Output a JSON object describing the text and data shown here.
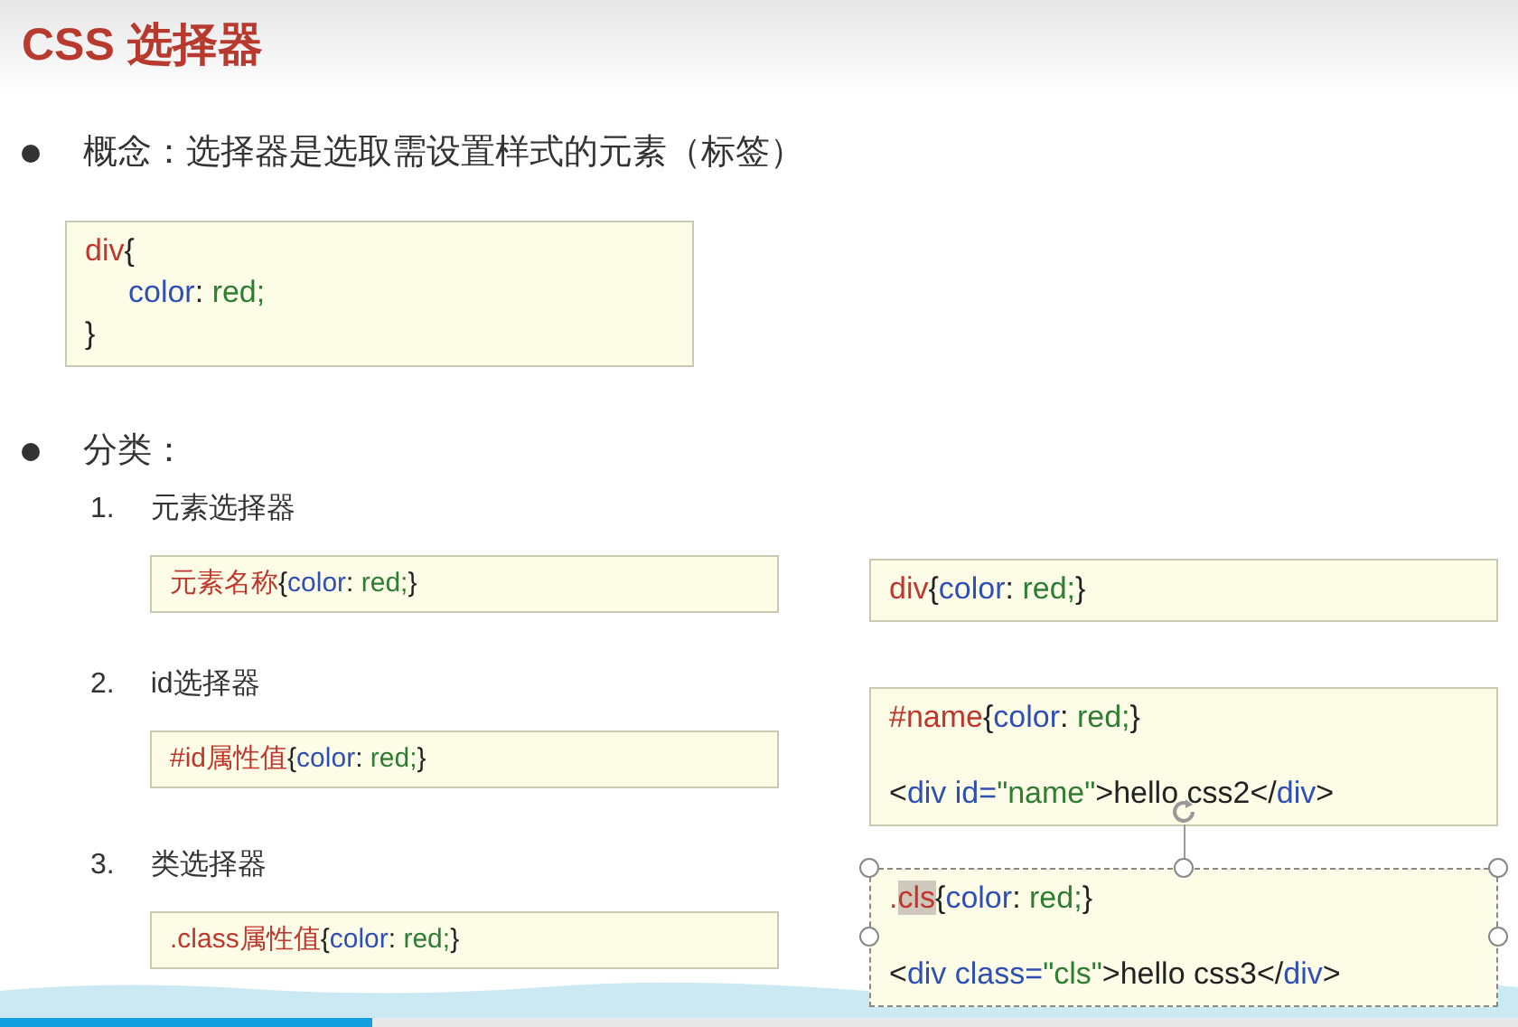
{
  "slide": {
    "title": "CSS 选择器",
    "concept": {
      "text": "概念：选择器是选取需设置样式的元素（标签）",
      "code": {
        "lines": [
          {
            "indented": false,
            "tokens": [
              {
                "text": "div",
                "kind": "selector"
              },
              {
                "text": "{",
                "kind": "plain"
              }
            ]
          },
          {
            "indented": true,
            "tokens": [
              {
                "text": "color",
                "kind": "property"
              },
              {
                "text": ": ",
                "kind": "plain"
              },
              {
                "text": "red;",
                "kind": "value"
              }
            ]
          },
          {
            "indented": false,
            "tokens": [
              {
                "text": "}",
                "kind": "plain"
              }
            ]
          }
        ]
      }
    },
    "category": {
      "text": "分类：",
      "items": [
        {
          "number": "1.",
          "label": "元素选择器",
          "syntax": {
            "lines": [
              {
                "indented": false,
                "tokens": [
                  {
                    "text": "元素名称",
                    "kind": "selector"
                  },
                  {
                    "text": "{",
                    "kind": "plain"
                  },
                  {
                    "text": "color",
                    "kind": "property"
                  },
                  {
                    "text": ": ",
                    "kind": "plain"
                  },
                  {
                    "text": "red;",
                    "kind": "value"
                  },
                  {
                    "text": "}",
                    "kind": "plain"
                  }
                ]
              }
            ]
          },
          "example": {
            "selected": false,
            "lines": [
              {
                "indented": false,
                "tokens": [
                  {
                    "text": "div",
                    "kind": "selector"
                  },
                  {
                    "text": "{",
                    "kind": "plain"
                  },
                  {
                    "text": "color",
                    "kind": "property"
                  },
                  {
                    "text": ": ",
                    "kind": "plain"
                  },
                  {
                    "text": "red;",
                    "kind": "value"
                  },
                  {
                    "text": "}",
                    "kind": "plain"
                  }
                ]
              }
            ]
          }
        },
        {
          "number": "2.",
          "label": "id选择器",
          "syntax": {
            "lines": [
              {
                "indented": false,
                "tokens": [
                  {
                    "text": "#id属性值",
                    "kind": "selector"
                  },
                  {
                    "text": "{",
                    "kind": "plain"
                  },
                  {
                    "text": "color",
                    "kind": "property"
                  },
                  {
                    "text": ": ",
                    "kind": "plain"
                  },
                  {
                    "text": "red;",
                    "kind": "value"
                  },
                  {
                    "text": "}",
                    "kind": "plain"
                  }
                ]
              }
            ]
          },
          "example": {
            "selected": false,
            "lines": [
              {
                "indented": false,
                "tokens": [
                  {
                    "text": "#name",
                    "kind": "selector"
                  },
                  {
                    "text": "{",
                    "kind": "plain"
                  },
                  {
                    "text": "color",
                    "kind": "property"
                  },
                  {
                    "text": ": ",
                    "kind": "plain"
                  },
                  {
                    "text": "red;",
                    "kind": "value"
                  },
                  {
                    "text": "}",
                    "kind": "plain"
                  }
                ]
              },
              {
                "indented": false,
                "tokens": [
                  {
                    "text": "<",
                    "kind": "plain"
                  },
                  {
                    "text": "div id=",
                    "kind": "property"
                  },
                  {
                    "text": "\"name\"",
                    "kind": "value"
                  },
                  {
                    "text": ">hello css2</",
                    "kind": "plain"
                  },
                  {
                    "text": "div",
                    "kind": "property"
                  },
                  {
                    "text": ">",
                    "kind": "plain"
                  }
                ]
              }
            ]
          }
        },
        {
          "number": "3.",
          "label": "类选择器",
          "syntax": {
            "lines": [
              {
                "indented": false,
                "tokens": [
                  {
                    "text": ".class属性值",
                    "kind": "selector"
                  },
                  {
                    "text": "{",
                    "kind": "plain"
                  },
                  {
                    "text": "color",
                    "kind": "property"
                  },
                  {
                    "text": ": ",
                    "kind": "plain"
                  },
                  {
                    "text": "red;",
                    "kind": "value"
                  },
                  {
                    "text": "}",
                    "kind": "plain"
                  }
                ]
              }
            ]
          },
          "example": {
            "selected": true,
            "lines": [
              {
                "indented": false,
                "tokens": [
                  {
                    "text": ".",
                    "kind": "selector"
                  },
                  {
                    "text": "cls",
                    "kind": "highlight"
                  },
                  {
                    "text": "{",
                    "kind": "plain"
                  },
                  {
                    "text": "color",
                    "kind": "property"
                  },
                  {
                    "text": ": ",
                    "kind": "plain"
                  },
                  {
                    "text": "red;",
                    "kind": "value"
                  },
                  {
                    "text": "}",
                    "kind": "plain"
                  }
                ]
              },
              {
                "indented": false,
                "tokens": [
                  {
                    "text": "<",
                    "kind": "plain"
                  },
                  {
                    "text": "div class=",
                    "kind": "property"
                  },
                  {
                    "text": "\"cls\"",
                    "kind": "value"
                  },
                  {
                    "text": ">hello css3</",
                    "kind": "plain"
                  },
                  {
                    "text": "div",
                    "kind": "property"
                  },
                  {
                    "text": ">",
                    "kind": "plain"
                  }
                ]
              }
            ]
          }
        }
      ]
    }
  },
  "player": {
    "progress": {
      "level": 0.245
    }
  }
}
